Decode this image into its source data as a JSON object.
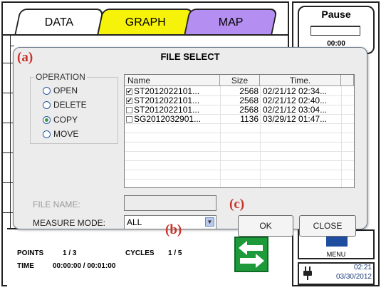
{
  "tabs": [
    {
      "label": "DATA"
    },
    {
      "label": "GRAPH"
    },
    {
      "label": "MAP"
    }
  ],
  "status_panel": {
    "state": "Pause",
    "elapsed": "00:00",
    "menu_label": "MENU",
    "clock_time": "02:21",
    "clock_date": "03/30/2012"
  },
  "stats": {
    "points_label": "POINTS",
    "points_value": "1 / 3",
    "cycles_label": "CYCLES",
    "cycles_value": "1 / 5",
    "time_label": "TIME",
    "time_value": "00:00:00 / 00:01:00"
  },
  "dialog": {
    "title": "FILE SELECT",
    "operation_label": "OPERATION",
    "operations": [
      {
        "label": "OPEN",
        "selected": false
      },
      {
        "label": "DELETE",
        "selected": false
      },
      {
        "label": "COPY",
        "selected": true
      },
      {
        "label": "MOVE",
        "selected": false
      }
    ],
    "table": {
      "columns": [
        "Name",
        "Size",
        "Time."
      ],
      "rows": [
        {
          "checked": true,
          "name": "ST2012022101...",
          "size": "2568",
          "time": "02/21/12 02:34..."
        },
        {
          "checked": true,
          "name": "ST2012022101...",
          "size": "2568",
          "time": "02/21/12 02:40..."
        },
        {
          "checked": false,
          "name": "ST2012022101...",
          "size": "2568",
          "time": "02/21/12 03:04..."
        },
        {
          "checked": false,
          "name": "SG2012032901...",
          "size": "1136",
          "time": "03/29/12 01:47..."
        }
      ]
    },
    "file_name_label": "FILE NAME:",
    "file_name_value": "",
    "measure_mode_label": "MEASURE MODE:",
    "measure_mode_value": "ALL",
    "ok_label": "OK",
    "close_label": "CLOSE"
  },
  "annotations": {
    "a": "(a)",
    "b": "(b)",
    "c": "(c)"
  },
  "colors": {
    "graph_tab": "#f6f20a",
    "map_tab": "#b48ef0",
    "annotation": "#c8322a",
    "swap_button": "#1e9a3a"
  }
}
